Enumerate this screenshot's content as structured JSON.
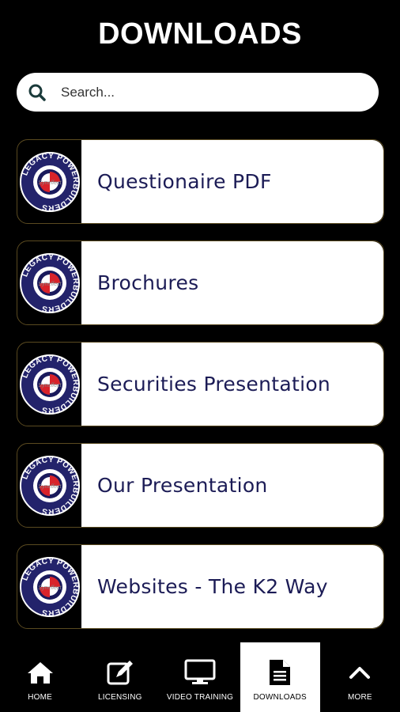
{
  "header": {
    "title": "DOWNLOADS"
  },
  "search": {
    "placeholder": "Search..."
  },
  "downloads": [
    {
      "label": "Questionaire PDF",
      "logo": "legacy-powerbuilders-logo"
    },
    {
      "label": "Brochures",
      "logo": "legacy-powerbuilders-logo"
    },
    {
      "label": "Securities Presentation",
      "logo": "legacy-powerbuilders-logo"
    },
    {
      "label": "Our Presentation",
      "logo": "legacy-powerbuilders-logo"
    },
    {
      "label": "Websites - The K2 Way",
      "logo": "legacy-powerbuilders-logo"
    }
  ],
  "logo_text": {
    "top": "LEGACY",
    "right": "POWERBUILDERS",
    "center": "Syneffect"
  },
  "tabs": [
    {
      "label": "HOME",
      "icon": "home-icon",
      "active": false
    },
    {
      "label": "LICENSING",
      "icon": "edit-icon",
      "active": false
    },
    {
      "label": "VIDEO TRAINING",
      "icon": "monitor-icon",
      "active": false
    },
    {
      "label": "DOWNLOADS",
      "icon": "document-icon",
      "active": true
    },
    {
      "label": "MORE",
      "icon": "chevron-up-icon",
      "active": false
    }
  ],
  "colors": {
    "background": "#000000",
    "card_text": "#1c1c56",
    "card_border": "#5a4a20"
  }
}
